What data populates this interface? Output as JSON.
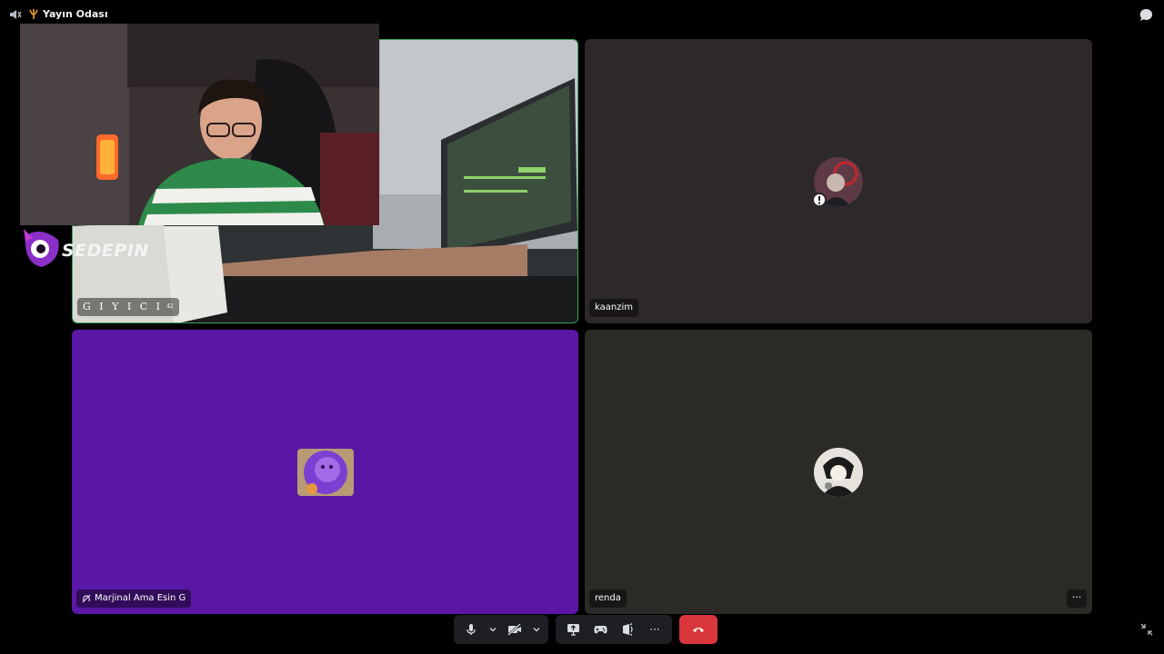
{
  "channel": {
    "title": "Yayın Odası"
  },
  "tiles": [
    {
      "name": "G I Y I C I",
      "superscript": "42"
    },
    {
      "name": "kaanzim"
    },
    {
      "name": "Marjinal Ama Esin G",
      "status_icon": "deafened-icon"
    },
    {
      "name": "renda",
      "more": "···"
    }
  ],
  "overlay": {
    "logo_text": "SEDEPIN"
  },
  "controls": {
    "mic": "microphone-icon",
    "camera": "camera-off-icon",
    "share": "screen-share-icon",
    "activity": "gamepad-icon",
    "soundboard": "soundboard-icon",
    "more": "···",
    "leave": "phone-hangup-icon"
  },
  "colors": {
    "speaking_border": "#3ba55d",
    "leave": "#da373c",
    "purple_tile": "#5a17a6"
  }
}
